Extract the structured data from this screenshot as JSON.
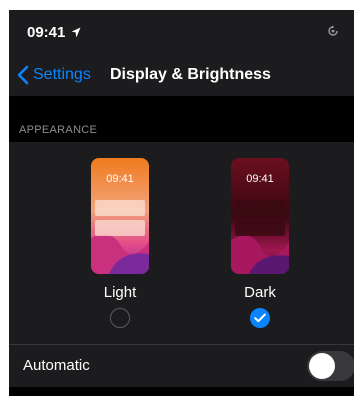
{
  "status_bar": {
    "time": "09:41",
    "location_icon": "location-arrow-icon",
    "rotation_lock_icon": "rotation-lock-icon"
  },
  "nav": {
    "back_label": "Settings",
    "back_icon": "chevron-left-icon",
    "title": "Display & Brightness"
  },
  "appearance": {
    "section_label": "APPEARANCE",
    "options": [
      {
        "label": "Light",
        "preview_time": "09:41",
        "selected": false
      },
      {
        "label": "Dark",
        "preview_time": "09:41",
        "selected": true
      }
    ]
  },
  "automatic": {
    "label": "Automatic",
    "enabled": false
  },
  "colors": {
    "accent": "#0a84ff",
    "background": "#000000",
    "panel": "#1c1c1e",
    "secondary_text": "#8e8e93"
  }
}
